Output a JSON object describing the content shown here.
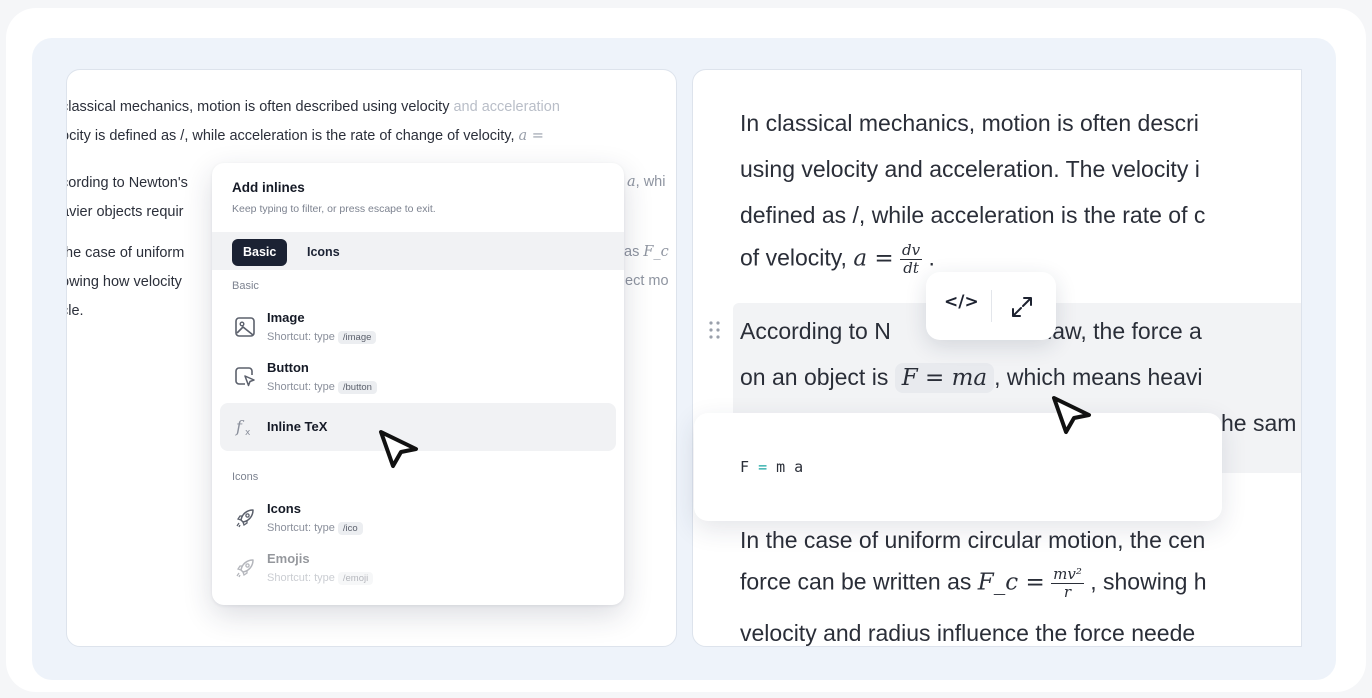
{
  "left_panel": {
    "lines": [
      {
        "text": "classical mechanics, motion is often described using velocity ",
        "fade": "and acceleration"
      },
      {
        "text": "ocity is defined as /, while acceleration is the rate of change of velocity,",
        "math": "a ="
      },
      {
        "text": "cording to Newton's"
      },
      {
        "text": "avier objects requir"
      },
      {
        "text": "the case of uniform"
      },
      {
        "text": "owing how velocity"
      },
      {
        "text": "cle."
      }
    ],
    "side": [
      {
        "math": "a",
        "text": ", whi"
      },
      {
        "text": "as",
        "math": "F_c"
      },
      {
        "text": "ect mo"
      }
    ]
  },
  "menu": {
    "title": "Add inlines",
    "subtitle": "Keep typing to filter, or press escape to exit.",
    "tabs": [
      "Basic",
      "Icons"
    ],
    "sections": [
      "Basic",
      "Icons"
    ],
    "shortcut_prefix": "Shortcut: type",
    "items": [
      {
        "label": "Image",
        "shortcut": "/image",
        "icon": "image-icon"
      },
      {
        "label": "Button",
        "shortcut": "/button",
        "icon": "button-icon"
      },
      {
        "label": "Inline TeX",
        "icon": "function-icon"
      },
      {
        "label": "Icons",
        "shortcut": "/ico",
        "icon": "rocket-icon"
      },
      {
        "label": "Emojis",
        "shortcut": "/emoji",
        "icon": "rocket-icon"
      }
    ]
  },
  "right_panel": {
    "para1": [
      "In classical mechanics, motion is often descri",
      "using velocity and acceleration. The velocity i",
      "defined as /, while acceleration is the rate of c",
      "of velocity,"
    ],
    "para1_math": "a =",
    "para1_frac": {
      "num": "dv",
      "den": "dt"
    },
    "para2_l1_a": "According to N",
    "para2_l1_b": "cond law, the force a",
    "para2_l2_a": "on an object is",
    "para2_l2_chip": "F = ma",
    "para2_l2_b": ", which means heavi",
    "para2_l3": "he sam",
    "para3": [
      "In the case of uniform circular motion, the cen",
      "velocity and radius influence the force neede"
    ],
    "para3_l2_a": "force can be written as",
    "para3_l2_math": "F_c =",
    "para3_frac": {
      "num": "mv²",
      "den": "r"
    },
    "para3_l2_b": ", showing h"
  },
  "toolbar": {
    "code_label": "</>",
    "expand_icon": "expand-icon"
  },
  "editor": {
    "code_a": "F ",
    "code_op": "=",
    "code_b": " m a"
  }
}
